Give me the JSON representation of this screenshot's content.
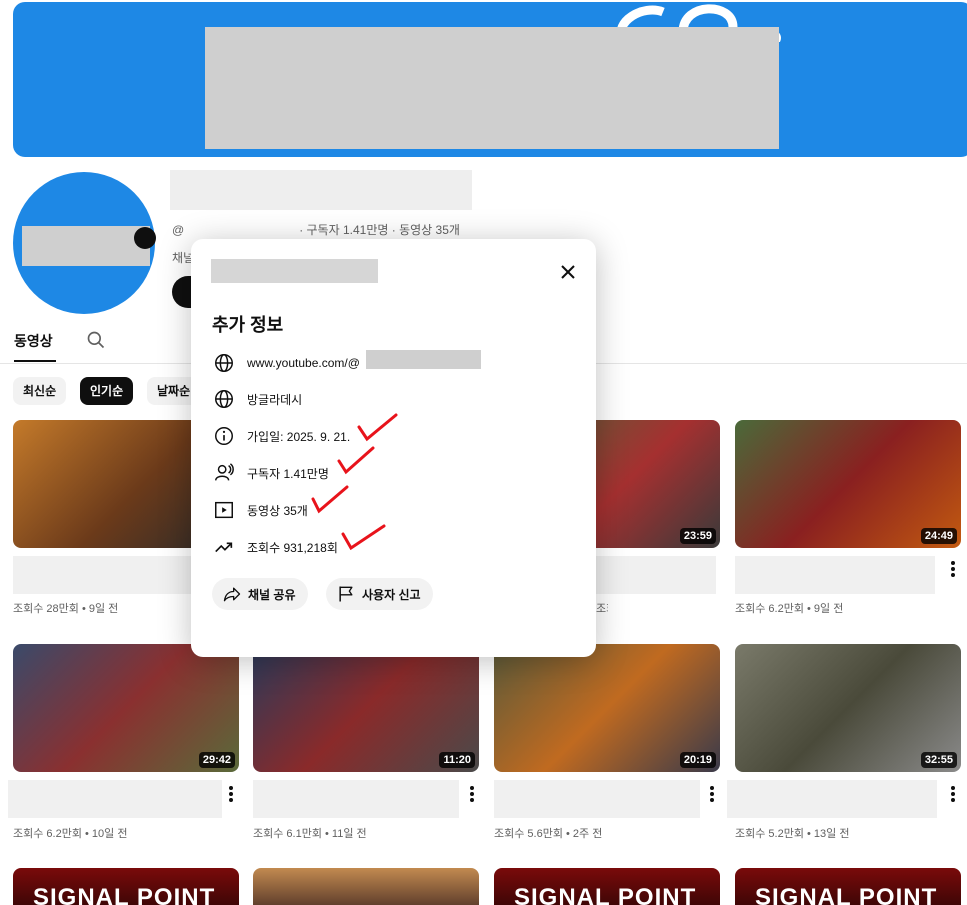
{
  "channel": {
    "handle_prefix": "@",
    "stats": "· 구독자 1.41만명 · 동영상 35개",
    "description_partial": "채널"
  },
  "tabs": {
    "videos": "동영상"
  },
  "chips": [
    {
      "label": "최신순",
      "active": false
    },
    {
      "label": "인기순",
      "active": true
    },
    {
      "label": "날짜순",
      "active": false
    }
  ],
  "videos": [
    {
      "meta": "조회수 28만회 • 9일 전",
      "duration": ""
    },
    {
      "meta": "",
      "duration": ""
    },
    {
      "meta": "조회수",
      "duration": "23:59"
    },
    {
      "meta": "조회수 6.2만회 • 9일 전",
      "duration": "24:49"
    },
    {
      "meta": "조회수 6.2만회 • 10일 전",
      "duration": "29:42"
    },
    {
      "meta": "조회수 6.1만회 • 11일 전",
      "duration": "11:20"
    },
    {
      "meta": "조회수 5.6만회 • 2주 전",
      "duration": "20:19"
    },
    {
      "meta": "조회수 5.2만회 • 13일 전",
      "duration": "32:55"
    }
  ],
  "signal_text": "SIGNAL POINT",
  "modal": {
    "heading": "추가 정보",
    "rows": [
      {
        "icon": "globe-icon",
        "text": "www.youtube.com/@"
      },
      {
        "icon": "globe-icon",
        "text": "방글라데시"
      },
      {
        "icon": "info-icon",
        "text": "가입일: 2025. 9. 21."
      },
      {
        "icon": "person-icon",
        "text": "구독자 1.41만명"
      },
      {
        "icon": "video-icon",
        "text": "동영상 35개"
      },
      {
        "icon": "trending-icon",
        "text": "조회수 931,218회"
      }
    ],
    "share_label": "채널 공유",
    "report_label": "사용자 신고"
  },
  "colors": {
    "banner": "#1e88e5",
    "check_marks": "#e8131b"
  }
}
